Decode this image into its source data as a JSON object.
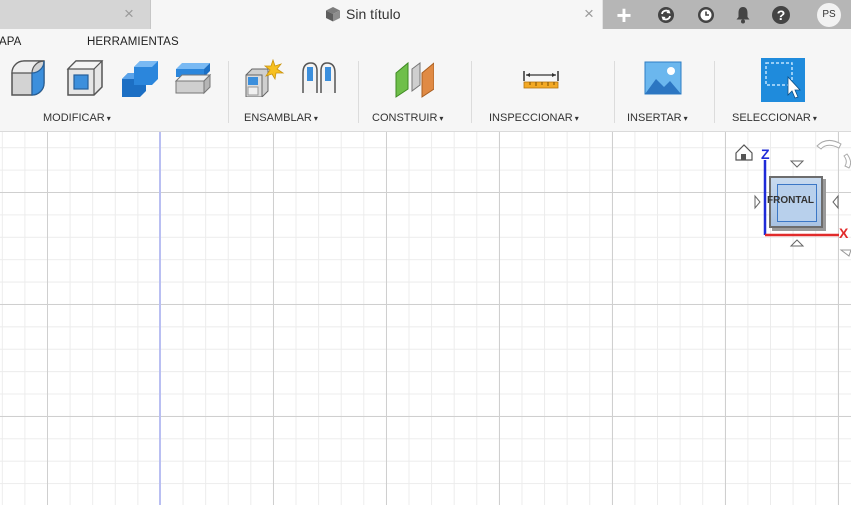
{
  "tabs": {
    "active_title": "Sin título",
    "close_glyph": "×"
  },
  "tab_actions": [
    {
      "name": "new-tab-icon",
      "glyph": "+"
    },
    {
      "name": "sync-icon"
    },
    {
      "name": "history-icon"
    },
    {
      "name": "bell-icon"
    },
    {
      "name": "help-icon",
      "glyph": "?"
    }
  ],
  "user": {
    "initials": "PS"
  },
  "menu": {
    "items": [
      "APA",
      "HERRAMIENTAS"
    ]
  },
  "toolbar": {
    "groups": [
      {
        "label": "MODIFICAR",
        "caret": "▾"
      },
      {
        "label": "ENSAMBLAR",
        "caret": "▾"
      },
      {
        "label": "CONSTRUIR",
        "caret": "▾"
      },
      {
        "label": "INSPECCIONAR",
        "caret": "▾"
      },
      {
        "label": "INSERTAR",
        "caret": "▾"
      },
      {
        "label": "SELECCIONAR",
        "caret": "▾"
      }
    ]
  },
  "viewcube": {
    "face_label": "FRONTAL",
    "z_label": "Z",
    "x_label": "X"
  },
  "colors": {
    "accent_blue": "#1f8bdc",
    "z_axis": "#1f2bd8",
    "x_axis": "#e12b2b",
    "construir_green": "#6fbf4a",
    "construir_orange": "#e08a44"
  }
}
